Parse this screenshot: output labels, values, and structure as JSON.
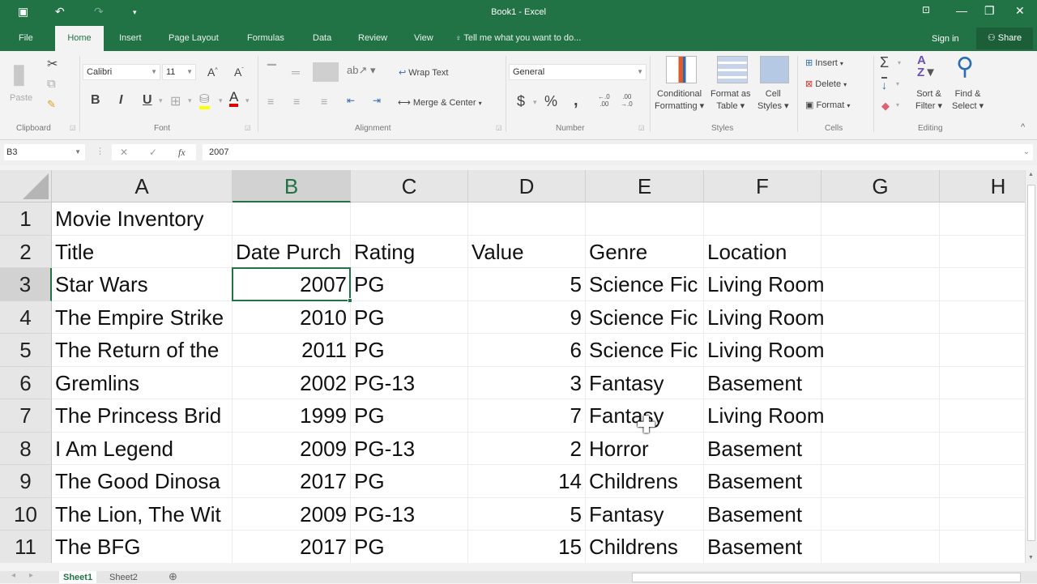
{
  "window": {
    "title": "Book1 - Excel",
    "save_icon": "💾",
    "undo_icon": "↶",
    "redo_icon": "↷",
    "customize_icon": "▾",
    "ribbon_display_icon": "⊡",
    "minimize_icon": "—",
    "restore_icon": "❐",
    "close_icon": "✕"
  },
  "tabs": [
    {
      "label": "File"
    },
    {
      "label": "Home",
      "active": true
    },
    {
      "label": "Insert"
    },
    {
      "label": "Page Layout"
    },
    {
      "label": "Formulas"
    },
    {
      "label": "Data"
    },
    {
      "label": "Review"
    },
    {
      "label": "View"
    }
  ],
  "tell_me": "Tell me what you want to do...",
  "tell_me_icon": "💡",
  "sign_in": "Sign in",
  "share": "Share",
  "share_icon": "👤",
  "ribbon": {
    "clipboard": {
      "label": "Clipboard",
      "paste": "Paste",
      "paste_icon": "📋",
      "cut_icon": "✂",
      "copy_icon": "⧉",
      "format_painter_icon": "🖌"
    },
    "font": {
      "label": "Font",
      "font_name": "Calibri",
      "font_size": "11",
      "grow_icon": "A˄",
      "shrink_icon": "A˅",
      "bold": "B",
      "italic": "I",
      "underline": "U",
      "borders_icon": "⊞",
      "fill_icon": "◈",
      "font_color_icon": "A",
      "fill_color": "#ffff00",
      "font_color": "#e00000"
    },
    "alignment": {
      "label": "Alignment",
      "wrap_text": "Wrap Text",
      "merge_center": "Merge & Center",
      "orientation_icon": "ab↗"
    },
    "number": {
      "label": "Number",
      "format": "General",
      "currency": "$",
      "percent": "%",
      "comma": ",",
      "inc_decimal": "←.0 .00",
      "dec_decimal": ".00 →.0"
    },
    "styles": {
      "label": "Styles",
      "conditional": [
        "Conditional",
        "Formatting ▾"
      ],
      "format_table": [
        "Format as",
        "Table ▾"
      ],
      "cell_styles": [
        "Cell",
        "Styles ▾"
      ]
    },
    "cells": {
      "label": "Cells",
      "insert": "Insert",
      "delete": "Delete",
      "format": "Format"
    },
    "editing": {
      "label": "Editing",
      "autosum_icon": "Σ",
      "fill_icon": "↓",
      "clear_icon": "◆",
      "sort_filter": [
        "Sort &",
        "Filter ▾"
      ],
      "find_select": [
        "Find &",
        "Select ▾"
      ],
      "sort_icon": "A↓Z",
      "find_icon": "🔍",
      "collapse_icon": "^"
    }
  },
  "formula_bar": {
    "name_box": "B3",
    "cancel_icon": "✕",
    "enter_icon": "✓",
    "fx": "fx",
    "value": "2007",
    "expand_icon": "⌄"
  },
  "sheet": {
    "columns": [
      "A",
      "B",
      "C",
      "D",
      "E",
      "F",
      "G",
      "H"
    ],
    "selected_column": "B",
    "selected_row": 3,
    "active_cell": "B3",
    "rows": [
      {
        "n": "1",
        "A": "Movie Inventory",
        "B": "",
        "C": "",
        "D": "",
        "E": "",
        "F": ""
      },
      {
        "n": "2",
        "A": "Title",
        "B": "Date Purch",
        "C": "Rating",
        "D": "Value",
        "E": "Genre",
        "F": "Location"
      },
      {
        "n": "3",
        "A": "Star Wars",
        "B": "2007",
        "C": "PG",
        "D": "5",
        "E": "Science Fic",
        "F": "Living Room"
      },
      {
        "n": "4",
        "A": "The Empire Strike",
        "B": "2010",
        "C": "PG",
        "D": "9",
        "E": "Science Fic",
        "F": "Living Room"
      },
      {
        "n": "5",
        "A": "The Return of the",
        "B": "2011",
        "C": "PG",
        "D": "6",
        "E": "Science Fic",
        "F": "Living Room"
      },
      {
        "n": "6",
        "A": "Gremlins",
        "B": "2002",
        "C": "PG-13",
        "D": "3",
        "E": "Fantasy",
        "F": "Basement"
      },
      {
        "n": "7",
        "A": "The Princess Brid",
        "B": "1999",
        "C": "PG",
        "D": "7",
        "E": "Fantasy",
        "F": "Living Room"
      },
      {
        "n": "8",
        "A": "I Am Legend",
        "B": "2009",
        "C": "PG-13",
        "D": "2",
        "E": "Horror",
        "F": "Basement"
      },
      {
        "n": "9",
        "A": "The Good Dinosa",
        "B": "2017",
        "C": "PG",
        "D": "14",
        "E": "Childrens",
        "F": "Basement"
      },
      {
        "n": "10",
        "A": "The Lion, The Wit",
        "B": "2009",
        "C": "PG-13",
        "D": "5",
        "E": "Fantasy",
        "F": "Basement"
      },
      {
        "n": "11",
        "A": "The BFG",
        "B": "2017",
        "C": "PG",
        "D": "15",
        "E": "Childrens",
        "F": "Basement"
      }
    ]
  },
  "sheet_tabs": [
    {
      "label": "Sheet1",
      "active": true
    },
    {
      "label": "Sheet2"
    }
  ],
  "add_sheet_icon": "⊕",
  "cursor_icon": "✚",
  "scroll_up_icon": "▲",
  "scroll_down_icon": "▼"
}
